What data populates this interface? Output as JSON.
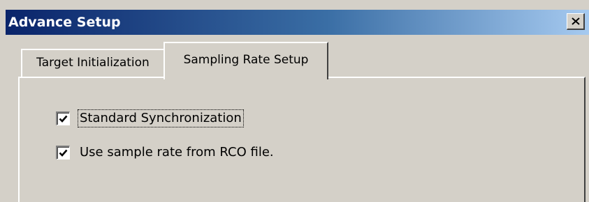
{
  "window": {
    "title": "Advance Setup",
    "close_icon": "close-icon"
  },
  "tabs": [
    {
      "label": "Target Initialization",
      "selected": false
    },
    {
      "label": "Sampling Rate Setup",
      "selected": true
    }
  ],
  "options": [
    {
      "label": "Standard Synchronization",
      "checked": true,
      "focused": true
    },
    {
      "label": "Use sample rate from RCO file.",
      "checked": true,
      "focused": false
    }
  ],
  "colors": {
    "titlebar_start": "#0a246a",
    "titlebar_end": "#a6caf0",
    "face": "#d4d0c8"
  }
}
